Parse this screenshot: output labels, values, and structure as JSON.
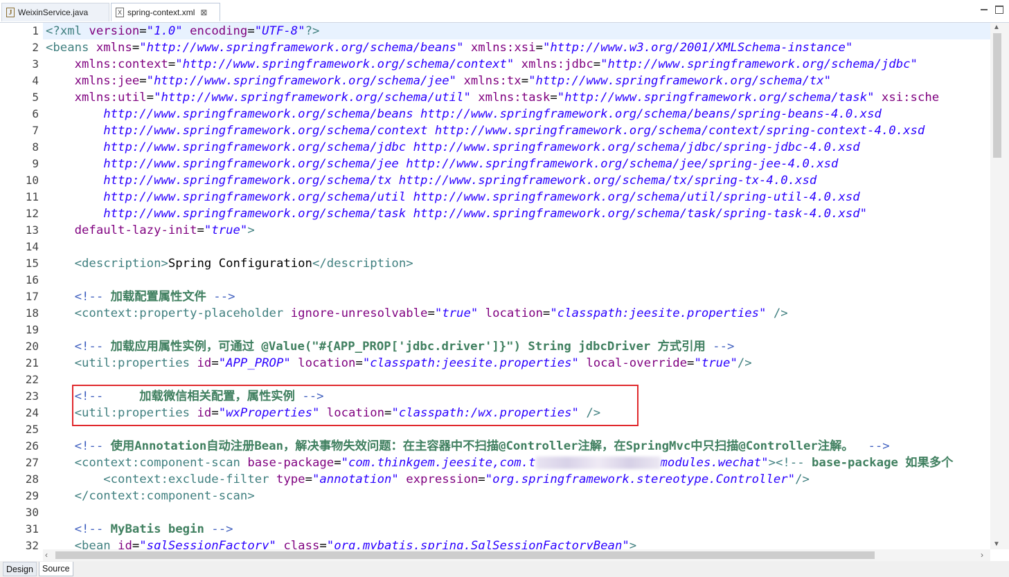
{
  "tabs": [
    {
      "label": "WeixinService.java",
      "icon": "java-file-icon"
    },
    {
      "label": "spring-context.xml",
      "icon": "xml-file-icon",
      "close": "⊠"
    }
  ],
  "line_numbers": [
    "1",
    "2",
    "3",
    "4",
    "5",
    "6",
    "7",
    "8",
    "9",
    "10",
    "11",
    "12",
    "13",
    "14",
    "15",
    "16",
    "17",
    "18",
    "19",
    "20",
    "21",
    "22",
    "23",
    "24",
    "25",
    "26",
    "27",
    "28",
    "29",
    "30",
    "31",
    "32"
  ],
  "code": {
    "l1": [
      "<?",
      "xml",
      " version",
      "=",
      "\"1.0\"",
      " encoding",
      "=",
      "\"UTF-8\"",
      "?>"
    ],
    "l2": [
      "<beans",
      " xmlns",
      "=",
      "\"http://www.springframework.org/schema/beans\"",
      " xmlns:xsi",
      "=",
      "\"http://www.w3.org/2001/XMLSchema-instance\""
    ],
    "l3": [
      "    xmlns:context",
      "=",
      "\"http://www.springframework.org/schema/context\"",
      " xmlns:jdbc",
      "=",
      "\"http://www.springframework.org/schema/jdbc\""
    ],
    "l4": [
      "    xmlns:jee",
      "=",
      "\"http://www.springframework.org/schema/jee\"",
      " xmlns:tx",
      "=",
      "\"http://www.springframework.org/schema/tx\""
    ],
    "l5": [
      "    xmlns:util",
      "=",
      "\"http://www.springframework.org/schema/util\"",
      " xmlns:task",
      "=",
      "\"http://www.springframework.org/schema/task\"",
      " xsi:sche"
    ],
    "l6": "        http://www.springframework.org/schema/beans http://www.springframework.org/schema/beans/spring-beans-4.0.xsd",
    "l7": "        http://www.springframework.org/schema/context http://www.springframework.org/schema/context/spring-context-4.0.xsd",
    "l8": "        http://www.springframework.org/schema/jdbc http://www.springframework.org/schema/jdbc/spring-jdbc-4.0.xsd",
    "l9": "        http://www.springframework.org/schema/jee http://www.springframework.org/schema/jee/spring-jee-4.0.xsd",
    "l10": "        http://www.springframework.org/schema/tx http://www.springframework.org/schema/tx/spring-tx-4.0.xsd",
    "l11": "        http://www.springframework.org/schema/util http://www.springframework.org/schema/util/spring-util-4.0.xsd",
    "l12": "        http://www.springframework.org/schema/task http://www.springframework.org/schema/task/spring-task-4.0.xsd\"",
    "l13": [
      "    default-lazy-init",
      "=",
      "\"true\"",
      ">"
    ],
    "l15": [
      "    <description>",
      "Spring Configuration",
      "</description>"
    ],
    "l17": [
      "    <!-- ",
      "加载配置属性文件",
      " -->"
    ],
    "l18": [
      "    <context:property-placeholder",
      " ignore-unresolvable",
      "=",
      "\"true\"",
      " location",
      "=",
      "\"classpath:jeesite.properties\"",
      " />"
    ],
    "l20": [
      "    <!-- ",
      "加载应用属性实例，可通过 @Value(\"#{APP_PROP['jdbc.driver']}\") String jdbcDriver 方式引用",
      " -->"
    ],
    "l21": [
      "    <util:properties",
      " id",
      "=",
      "\"APP_PROP\"",
      " location",
      "=",
      "\"classpath:jeesite.properties\"",
      " local-override",
      "=",
      "\"true\"",
      "/>"
    ],
    "l23": [
      "    <!--     ",
      "加载微信相关配置，属性实例",
      " -->"
    ],
    "l24": [
      "    <util:properties",
      " id",
      "=",
      "\"wxProperties\"",
      " location",
      "=",
      "\"classpath:/wx.properties\"",
      " />"
    ],
    "l26": [
      "    <!-- ",
      "使用Annotation自动注册Bean，解决事物失效问题：在主容器中不扫描@Controller注解，在SpringMvc中只扫描@Controller注解。",
      "  -->"
    ],
    "l27": [
      "    <context:component-scan",
      " base-package",
      "=",
      "\"com.thinkgem.jeesite,com.t",
      "modules.wechat\"",
      "><!-- ",
      "base-package 如果多个"
    ],
    "l28": [
      "        <context:exclude-filter",
      " type",
      "=",
      "\"annotation\"",
      " expression",
      "=",
      "\"org.springframework.stereotype.Controller\"",
      "/>"
    ],
    "l29": "    </context:component-scan>",
    "l31": [
      "    <!-- ",
      "MyBatis begin",
      " -->"
    ],
    "l32": [
      "    <bean",
      " id",
      "=",
      "\"sqlSessionFactory\"",
      " class",
      "=",
      "\"org.mybatis.spring.SqlSessionFactoryBean\"",
      ">"
    ]
  },
  "bottom_tabs": {
    "design": "Design",
    "source": "Source"
  },
  "colors": {
    "tag": "#3f7f7f",
    "attr_name": "#7f007f",
    "attr_value": "#2a00ff",
    "comment": "#3f5fbf",
    "comment_text": "#3f7f5f",
    "highlight_box": "#e0282c"
  }
}
